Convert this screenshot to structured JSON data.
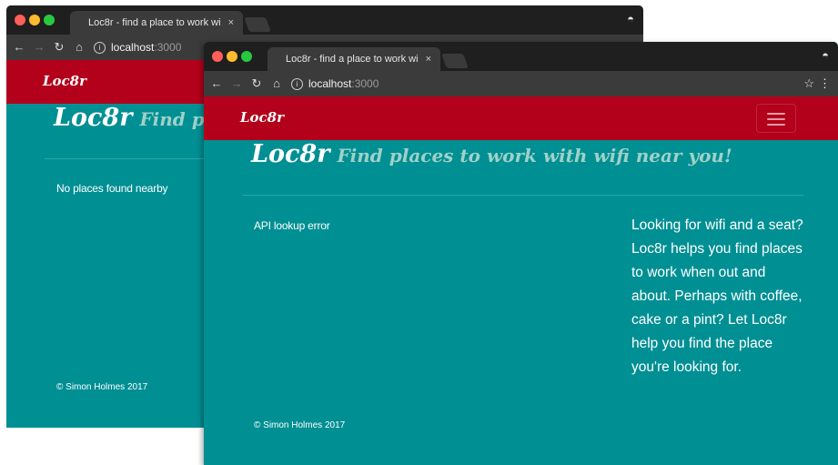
{
  "back_window": {
    "tab_title": "Loc8r - find a place to work wi",
    "tab_close": "×",
    "url_host": "localhost",
    "url_port": ":3000",
    "brand": "Loc8r",
    "header_brand": "Loc8r",
    "header_tagline": "Find pla",
    "message": "No places found nearby",
    "footer": "© Simon Holmes 2017"
  },
  "front_window": {
    "tab_title": "Loc8r - find a place to work wi",
    "tab_close": "×",
    "url_host": "localhost",
    "url_port": ":3000",
    "brand": "Loc8r",
    "header_brand": "Loc8r",
    "header_tagline": "Find places to work with wifi near you!",
    "message": "API lookup error",
    "sidebar": "Looking for wifi and a seat? Loc8r helps you find places to work when out and about. Perhaps with coffee, cake or a pint? Let Loc8r help you find the place you're looking for.",
    "footer": "© Simon Holmes 2017"
  },
  "colors": {
    "page_background": "#008f93",
    "navbar": "#b3001b",
    "tagline": "#9fd1c8",
    "browser_chrome": "#3b3b3b"
  },
  "icons": {
    "back": "arrow-left-icon",
    "forward": "arrow-right-icon",
    "reload": "reload-icon",
    "home": "home-icon",
    "info": "info-icon",
    "bookmark": "star-icon",
    "menu": "kebab-menu-icon",
    "incognito": "incognito-icon",
    "nav_toggle": "hamburger-icon"
  }
}
